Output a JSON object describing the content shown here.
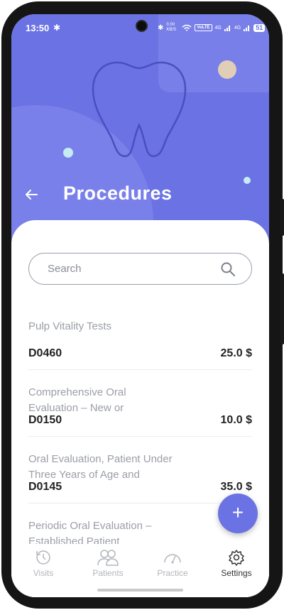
{
  "status_bar": {
    "time": "13:50",
    "bluetooth_icon": "bluetooth-icon",
    "data_speed": "0.00 KB/S",
    "volte": "VoLTE",
    "network_1": "4G",
    "network_2": "4G",
    "battery": "51"
  },
  "header": {
    "title": "Procedures",
    "back_icon": "arrow-left-icon"
  },
  "search": {
    "placeholder": "Search"
  },
  "procedures": [
    {
      "name": "Pulp Vitality Tests",
      "code": "D0460",
      "price": "25.0 $"
    },
    {
      "name": "Comprehensive Oral Evaluation – New or",
      "code": "D0150",
      "price": "10.0 $"
    },
    {
      "name": "Oral Evaluation, Patient Under Three Years of Age and",
      "code": "D0145",
      "price": "35.0 $"
    },
    {
      "name": "Periodic Oral Evaluation – Established Patient",
      "code": "",
      "price": ""
    }
  ],
  "fab": {
    "label": "+"
  },
  "nav": {
    "items": [
      {
        "label": "Visits",
        "icon": "clock-history-icon"
      },
      {
        "label": "Patients",
        "icon": "people-icon"
      },
      {
        "label": "Practice",
        "icon": "gauge-icon"
      },
      {
        "label": "Settings",
        "icon": "gear-icon"
      }
    ],
    "active": "Settings"
  },
  "colors": {
    "accent": "#6b72e3",
    "header_light": "#7a80ea",
    "dot_beige": "#e0cfb6",
    "dot_cyan": "#c5ecf4"
  }
}
